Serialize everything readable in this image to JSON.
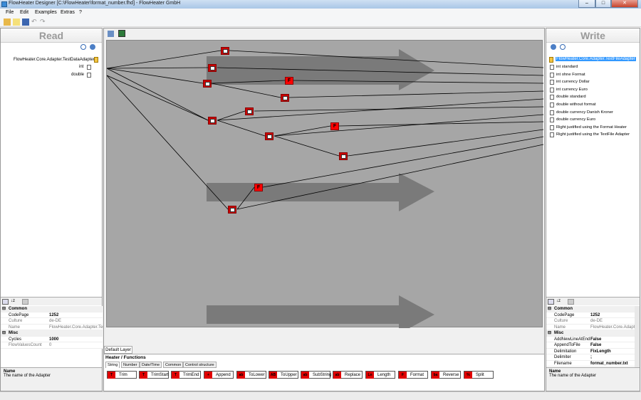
{
  "window": {
    "title": "FlowHeater Designer [C:\\FlowHeater\\format_number.fhd] - FlowHeater GmbH",
    "min": "–",
    "max": "□",
    "close": "✕"
  },
  "menu": [
    "File",
    "Edit",
    "Examples",
    "Extras",
    "?"
  ],
  "read": {
    "header": "Read",
    "adapter": "FlowHeater.Core.Adapter.TestDataAdapter",
    "fields": [
      "int",
      "double"
    ]
  },
  "write": {
    "header": "Write",
    "adapter": "FlowHeater.Core.Adapter.TextFileAdapter",
    "fields": [
      "int standard",
      "int ohne Format",
      "int currency Dollar",
      "int currency Euro",
      "double standard",
      "double without format",
      "double currency Danish Kroner",
      "double currency Euro",
      "Right justified using the Format Heater",
      "Right justified using the TextFile Adapter"
    ]
  },
  "read_props": {
    "cat1": "Common",
    "rows1": [
      [
        "CodePage",
        "1252"
      ],
      [
        "Culture",
        "de-DE"
      ],
      [
        "Name",
        "FlowHeater.Core.Adapter.Tes"
      ]
    ],
    "cat2": "Misc",
    "rows2": [
      [
        "Cycles",
        "1000"
      ],
      [
        "FlowValuesCount",
        "0"
      ]
    ],
    "desc_title": "Name",
    "desc_text": "The name of the Adapter"
  },
  "write_props": {
    "cat1": "Common",
    "rows1": [
      [
        "CodePage",
        "1252"
      ],
      [
        "Culture",
        "de-DE"
      ],
      [
        "Name",
        "FlowHeater.Core.Adapt"
      ]
    ],
    "cat2": "Misc",
    "rows2": [
      [
        "AddNewLineAtEnd",
        "False"
      ],
      [
        "AppendToFile",
        "False"
      ],
      [
        "Delimitation",
        "FixLength"
      ],
      [
        "Delimiter",
        ";"
      ],
      [
        "Filename",
        "format_number.txt"
      ]
    ],
    "desc_title": "Name",
    "desc_text": "The name of the Adapter"
  },
  "layer_tab": "Default Layer",
  "heater": {
    "title": "Heater / Functions",
    "tabs": [
      "String",
      "Number",
      "Date/Time",
      "Common",
      "Control structure"
    ],
    "buttons": [
      "Trim",
      "TrimStart",
      "TrimEnd",
      "Append",
      "ToLower",
      "ToUpper",
      "SubString",
      "Replace",
      "Length",
      "Format",
      "Reverse",
      "Split"
    ]
  },
  "colors": {
    "canvas": "#a6a6a6",
    "node": "#cc0000",
    "arrow": "#7a7a7a"
  }
}
